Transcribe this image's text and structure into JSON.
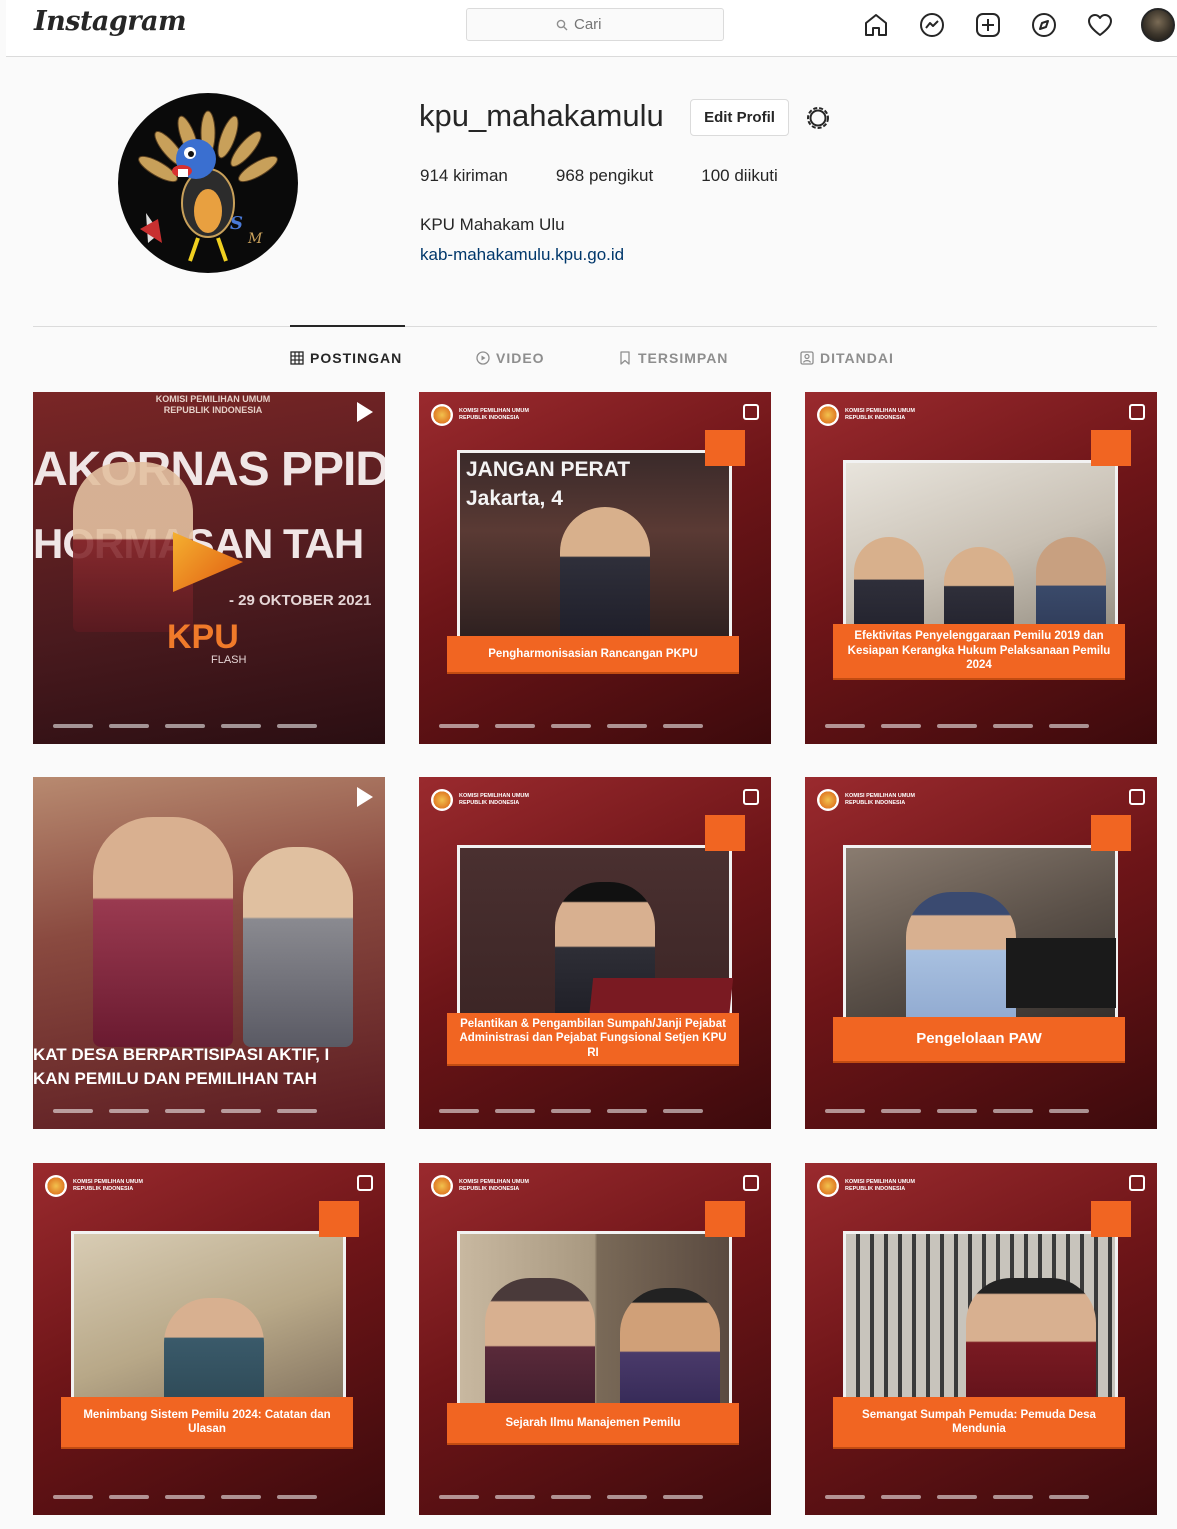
{
  "nav": {
    "logo": "Instagram",
    "search_placeholder": "Cari",
    "icons": [
      "home-icon",
      "messenger-icon",
      "new-post-icon",
      "explore-icon",
      "activity-heart-icon",
      "profile-avatar"
    ]
  },
  "profile": {
    "username": "kpu_mahakamulu",
    "edit_label": "Edit Profil",
    "stats": {
      "posts": "914 kiriman",
      "followers": "968 pengikut",
      "following": "100 diikuti"
    },
    "full_name": "KPU Mahakam Ulu",
    "website": "kab-mahakamulu.kpu.go.id"
  },
  "tabs": [
    {
      "label": "POSTINGAN",
      "icon": "grid-icon",
      "active": true
    },
    {
      "label": "VIDEO",
      "icon": "video-icon",
      "active": false
    },
    {
      "label": "TERSIMPAN",
      "icon": "bookmark-icon",
      "active": false
    },
    {
      "label": "DITANDAI",
      "icon": "tagged-icon",
      "active": false
    }
  ],
  "posts": [
    {
      "type": "video",
      "header": "KOMISI PEMILIHAN UMUM\nREPUBLIK INDONESIA",
      "big_text": "AKORNAS PPID K",
      "sub_text": "HORMASAN TAH",
      "date_text": "- 29 OKTOBER 2021",
      "brand": "KPU",
      "brand_sub": "FLASH"
    },
    {
      "type": "carousel",
      "caption": "Pengharmonisasian Rancangan PKPU",
      "photo_text": "JANGAN PERAT\nJakarta, 4"
    },
    {
      "type": "carousel",
      "caption": "Efektivitas Penyelenggaraan Pemilu 2019 dan Kesiapan Kerangka Hukum Pelaksanaan Pemilu 2024"
    },
    {
      "type": "video",
      "line1": "KAT DESA BERPARTISIPASI AKTIF, I",
      "line2": "KAN PEMILU DAN PEMILIHAN TAH"
    },
    {
      "type": "carousel",
      "caption": "Pelantikan & Pengambilan Sumpah/Janji Pejabat Administrasi dan Pejabat Fungsional Setjen KPU RI"
    },
    {
      "type": "carousel",
      "caption": "Pengelolaan PAW"
    },
    {
      "type": "carousel",
      "caption": "Menimbang Sistem Pemilu 2024: Catatan dan Ulasan"
    },
    {
      "type": "carousel",
      "caption": "Sejarah Ilmu Manajemen Pemilu"
    },
    {
      "type": "carousel",
      "caption": "Semangat Sumpah Pemuda: Pemuda Desa Mendunia"
    }
  ],
  "colors": {
    "brand_orange": "#f16522",
    "kpu_red": "#7a1a1d",
    "link": "#00376b"
  }
}
